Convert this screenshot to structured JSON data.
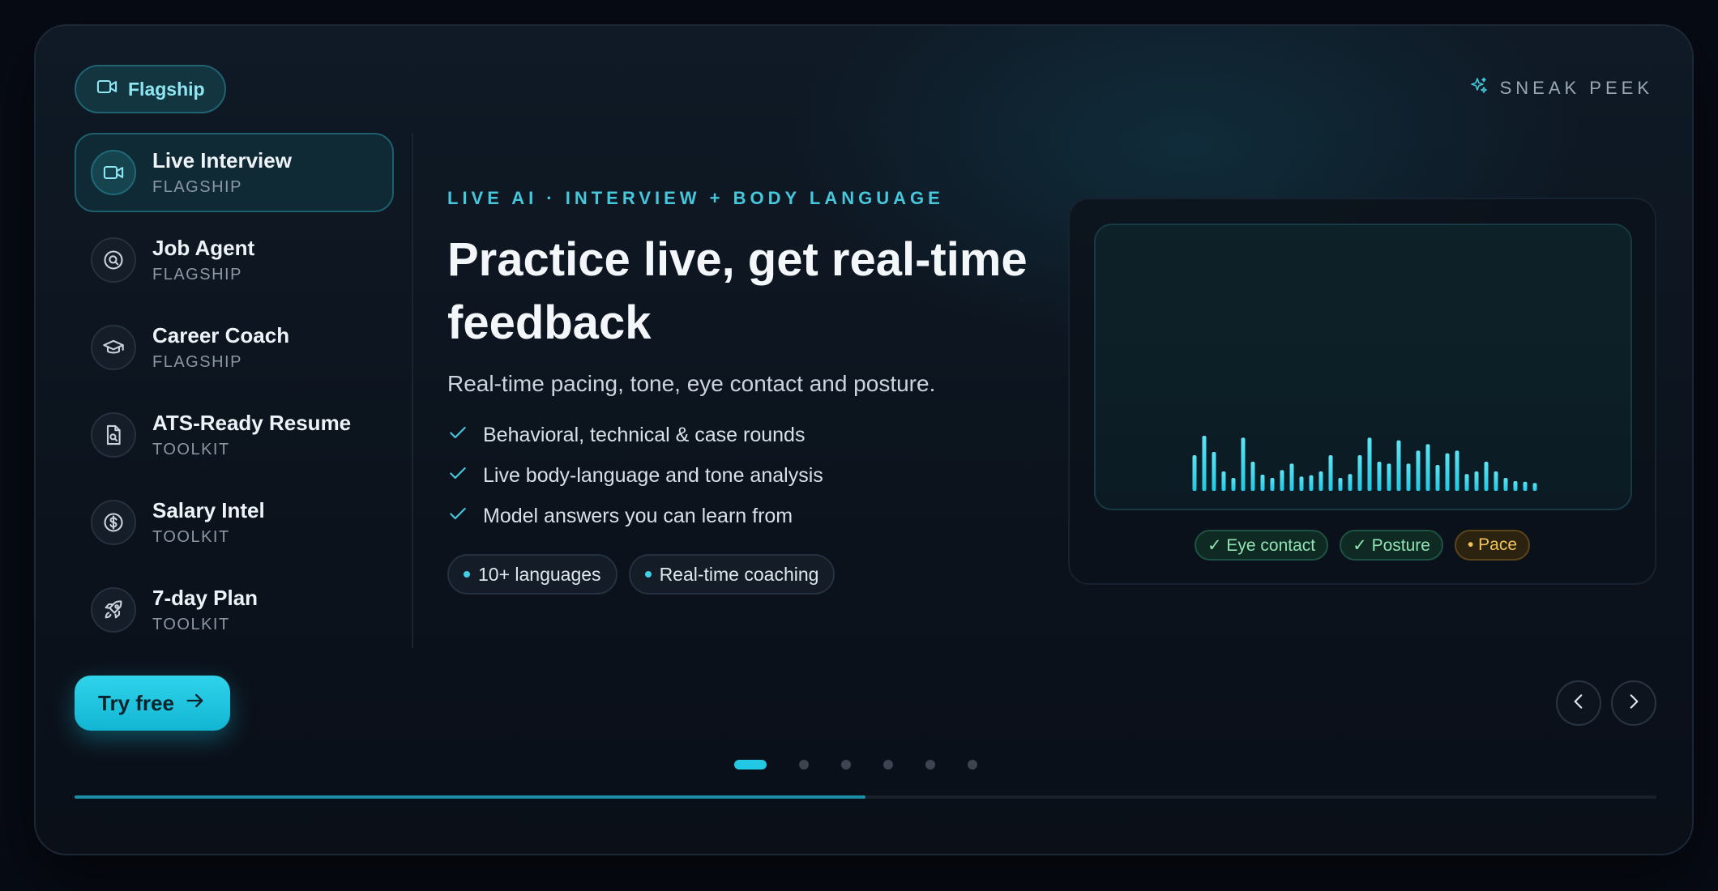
{
  "badge": {
    "label": "Flagship",
    "icon": "video-camera-icon"
  },
  "sneak_peek": {
    "label": "SNEAK PEEK",
    "icon": "sparkle-icon"
  },
  "sidebar": {
    "active_index": 0,
    "items": [
      {
        "title": "Live Interview",
        "tag": "FLAGSHIP",
        "icon": "video-camera-icon"
      },
      {
        "title": "Job Agent",
        "tag": "FLAGSHIP",
        "icon": "search-circle-icon"
      },
      {
        "title": "Career Coach",
        "tag": "FLAGSHIP",
        "icon": "graduation-cap-icon"
      },
      {
        "title": "ATS-Ready Resume",
        "tag": "TOOLKIT",
        "icon": "document-search-icon"
      },
      {
        "title": "Salary Intel",
        "tag": "TOOLKIT",
        "icon": "dollar-circle-icon"
      },
      {
        "title": "7-day Plan",
        "tag": "TOOLKIT",
        "icon": "rocket-icon"
      }
    ]
  },
  "main": {
    "eyebrow": "LIVE AI · INTERVIEW + BODY LANGUAGE",
    "headline": "Practice live, get real-time feedback",
    "subline": "Real-time pacing, tone, eye contact and posture.",
    "checks": [
      "Behavioral, technical & case rounds",
      "Live body-language and tone analysis",
      "Model answers you can learn from"
    ],
    "chips": [
      "10+ languages",
      "Real-time coaching"
    ]
  },
  "preview": {
    "waveform_levels": [
      0.55,
      0.85,
      0.6,
      0.3,
      0.2,
      0.82,
      0.45,
      0.25,
      0.2,
      0.32,
      0.42,
      0.22,
      0.24,
      0.3,
      0.55,
      0.2,
      0.26,
      0.55,
      0.82,
      0.45,
      0.42,
      0.78,
      0.42,
      0.62,
      0.72,
      0.4,
      0.58,
      0.62,
      0.26,
      0.3,
      0.45,
      0.3,
      0.2,
      0.15,
      0.14,
      0.12
    ],
    "pills": [
      {
        "label": "✓ Eye contact",
        "status": "ok"
      },
      {
        "label": "✓ Posture",
        "status": "ok"
      },
      {
        "label": "• Pace",
        "status": "warn"
      }
    ],
    "bar_color": "#22c8e4"
  },
  "cta": {
    "label": "Try free"
  },
  "pager": {
    "count": 6,
    "active": 0
  },
  "progress": {
    "fraction": 0.5
  },
  "colors": {
    "accent": "#22c8e4",
    "ok": "#8fe3b4",
    "warn": "#f0c45a"
  }
}
